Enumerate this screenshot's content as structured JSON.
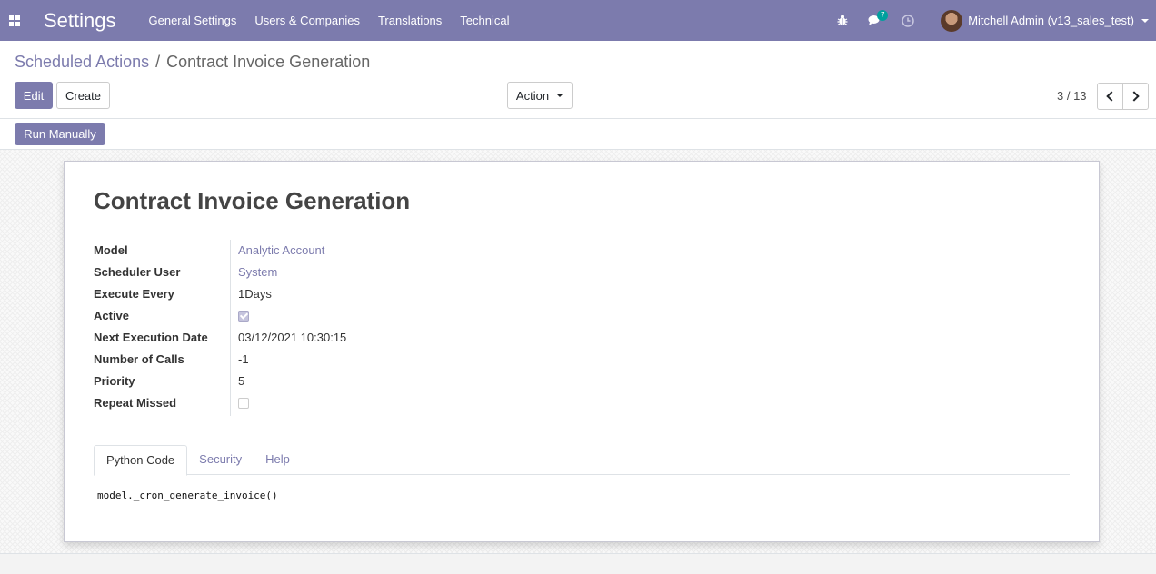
{
  "navbar": {
    "app_title": "Settings",
    "menu": [
      "General Settings",
      "Users & Companies",
      "Translations",
      "Technical"
    ],
    "messages_count": "7",
    "user_name": "Mitchell Admin (v13_sales_test)"
  },
  "breadcrumb": {
    "parent": "Scheduled Actions",
    "separator": "/",
    "current": "Contract Invoice Generation"
  },
  "toolbar": {
    "edit_label": "Edit",
    "create_label": "Create",
    "action_label": "Action",
    "pager_value": "3 / 13"
  },
  "statusbar": {
    "run_manually_label": "Run Manually"
  },
  "form": {
    "title": "Contract Invoice Generation",
    "fields": {
      "model_label": "Model",
      "model_value": "Analytic Account",
      "user_label": "Scheduler User",
      "user_value": "System",
      "interval_label": "Execute Every",
      "interval_value": "1Days",
      "active_label": "Active",
      "active_value": true,
      "nextcall_label": "Next Execution Date",
      "nextcall_value": "03/12/2021 10:30:15",
      "numbercall_label": "Number of Calls",
      "numbercall_value": "-1",
      "priority_label": "Priority",
      "priority_value": "5",
      "doall_label": "Repeat Missed",
      "doall_value": false
    },
    "tabs": [
      "Python Code",
      "Security",
      "Help"
    ],
    "active_tab": "Python Code",
    "code": "model._cron_generate_invoice()"
  },
  "colors": {
    "brand": "#7c7bad",
    "badge": "#00a09d"
  },
  "icons": [
    "apps-icon",
    "bug-icon",
    "chat-icon",
    "clock-icon",
    "chevron-left-icon",
    "chevron-right-icon"
  ]
}
